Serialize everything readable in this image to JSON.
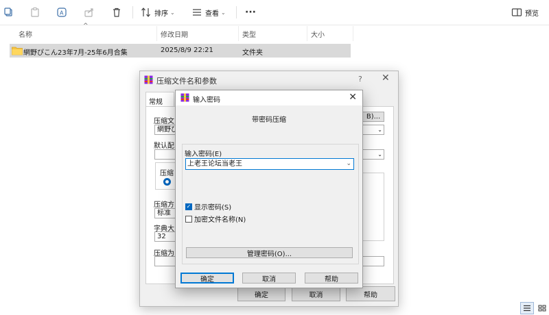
{
  "toolbar": {
    "sort_label": "排序",
    "view_label": "查看",
    "more_label": "···",
    "preview_label": "预览"
  },
  "columns": {
    "name": "名称",
    "modified": "修改日期",
    "type": "类型",
    "size": "大小"
  },
  "file": {
    "name": "網野ぴこん23年7月-25年6月合集",
    "modified": "2025/8/9 22:21",
    "type": "文件夹",
    "size": ""
  },
  "back_dialog": {
    "title": "压缩文件名和参数",
    "help_glyph": "?",
    "tab_general": "常规",
    "lbl_archive_name": "压缩文",
    "archive_name_value": "網野ぴ",
    "lbl_default": "默认配",
    "lbl_format": "压缩",
    "lbl_method": "压缩方",
    "method_value": "标准",
    "lbl_dict": "字典大",
    "dict_value": "32",
    "lbl_compress_to": "压缩为",
    "browse_label": "B)...",
    "ok_label": "确定",
    "cancel_label": "取消",
    "help_label": "帮助"
  },
  "front_dialog": {
    "title": "输入密码",
    "subtitle": "带密码压缩",
    "password_label": "输入密码(E)",
    "password_value": "上老王论坛当老王",
    "show_password": "显示密码(S)",
    "show_password_checked": true,
    "encrypt_names": "加密文件名称(N)",
    "encrypt_names_checked": false,
    "manage_label": "管理密码(O)...",
    "ok_label": "确定",
    "cancel_label": "取消",
    "help_label": "帮助",
    "check_glyph": "✓"
  },
  "colors": {
    "accent": "#0067c0",
    "selection": "#d9d9d9",
    "dialog_bg": "#f0f0f0"
  }
}
